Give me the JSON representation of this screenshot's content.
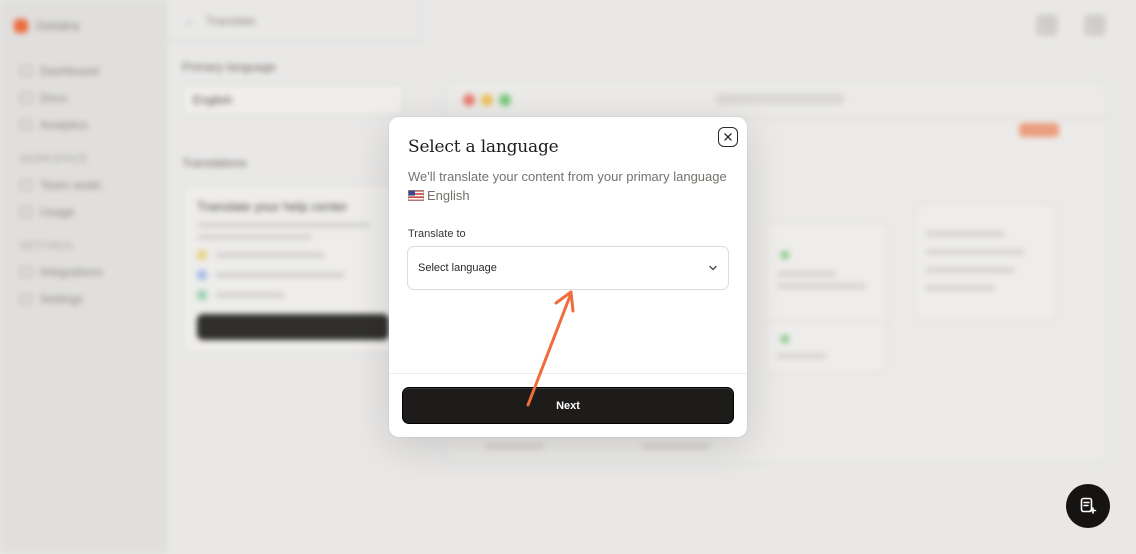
{
  "background": {
    "brand": "Getatra",
    "sidebar_items_top": [
      "Dashboard",
      "Docs",
      "Analytics"
    ],
    "sidebar_section_1": "Workspace",
    "sidebar_items_mid": [
      "Team seats",
      "Usage"
    ],
    "sidebar_section_2": "Settings",
    "sidebar_items_bottom": [
      "Integrations",
      "Settings"
    ],
    "topbar_title": "Translate",
    "primary_language_label": "Primary language",
    "primary_language_value": "English",
    "translations_label": "Translations",
    "card_title": "Translate your help center"
  },
  "modal": {
    "title": "Select a language",
    "description": "We'll translate your content from your primary language",
    "primary_language": "English",
    "field_label": "Translate to",
    "select_placeholder": "Select language",
    "next_label": "Next"
  },
  "annotation": {
    "arrow_color": "#F26B3A"
  },
  "colors": {
    "accent": "#F26B3A",
    "button_dark": "#1D1C1A"
  },
  "icons": {
    "close": "close-icon",
    "chevron": "chevron-down-icon",
    "flag": "us-flag-icon",
    "fab": "chat-compose-icon"
  }
}
